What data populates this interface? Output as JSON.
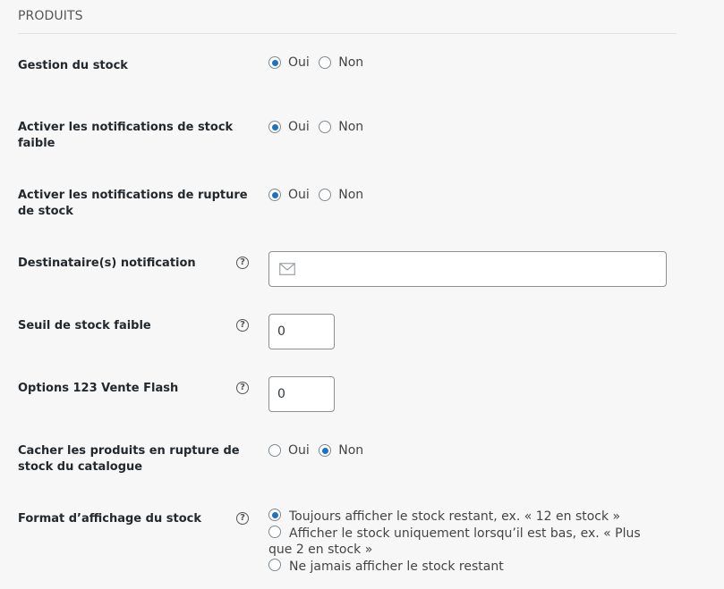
{
  "section": {
    "title": "PRODUITS"
  },
  "rows": {
    "manage_stock": {
      "label": "Gestion du stock",
      "options": [
        "Oui",
        "Non"
      ],
      "selected": "Oui"
    },
    "low_stock_notify": {
      "label": "Activer les notifications de stock faible",
      "options": [
        "Oui",
        "Non"
      ],
      "selected": "Oui"
    },
    "out_of_stock_notify": {
      "label": "Activer les notifications de rupture de stock",
      "options": [
        "Oui",
        "Non"
      ],
      "selected": "Oui"
    },
    "notification_recipients": {
      "label": "Destinataire(s) notification",
      "value": "",
      "help_icon": "question-circle-icon",
      "field_icon": "envelope-icon"
    },
    "low_stock_threshold": {
      "label": "Seuil de stock faible",
      "value": "0",
      "help_icon": "question-circle-icon"
    },
    "flash_sale_options": {
      "label": "Options 123 Vente Flash",
      "value": "0",
      "help_icon": "question-circle-icon"
    },
    "hide_out_of_stock": {
      "label": "Cacher les produits en rupture de stock du catalogue",
      "options": [
        "Oui",
        "Non"
      ],
      "selected": "Non"
    },
    "stock_display_format": {
      "label": "Format d’affichage du stock",
      "help_icon": "question-circle-icon",
      "options": [
        "Toujours afficher le stock restant, ex. « 12 en stock »",
        "Afficher le stock uniquement lorsqu’il est bas, ex. « Plus que 2 en stock »",
        "Ne jamais afficher le stock restant"
      ],
      "selected_index": 0
    }
  },
  "colors": {
    "accent": "#1e73be",
    "background": "#f7f7f7",
    "label_text": "#23282d"
  }
}
